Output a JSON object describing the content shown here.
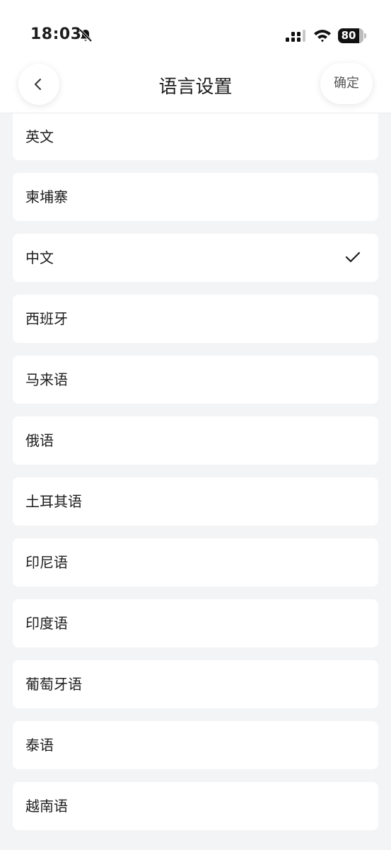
{
  "status_bar": {
    "time": "18:03",
    "battery_level": "80"
  },
  "header": {
    "title": "语言设置",
    "confirm_label": "确定"
  },
  "languages": [
    {
      "label": "英文",
      "selected": false
    },
    {
      "label": "柬埔寨",
      "selected": false
    },
    {
      "label": "中文",
      "selected": true
    },
    {
      "label": "西班牙",
      "selected": false
    },
    {
      "label": "马来语",
      "selected": false
    },
    {
      "label": "俄语",
      "selected": false
    },
    {
      "label": "土耳其语",
      "selected": false
    },
    {
      "label": "印尼语",
      "selected": false
    },
    {
      "label": "印度语",
      "selected": false
    },
    {
      "label": "葡萄牙语",
      "selected": false
    },
    {
      "label": "泰语",
      "selected": false
    },
    {
      "label": "越南语",
      "selected": false
    }
  ],
  "colors": {
    "background": "#f3f4f6",
    "card": "#ffffff",
    "text": "#1d1d1f"
  }
}
